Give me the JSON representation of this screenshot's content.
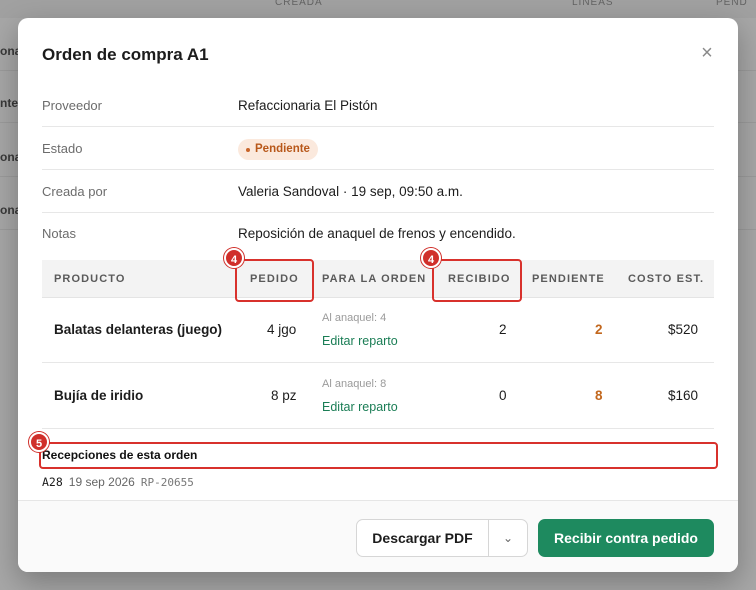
{
  "background": {
    "col_creada": "CREADA",
    "col_lineas": "LINEAS",
    "col_pend": "PEND",
    "row_texts": [
      "ona",
      "nte",
      "ona",
      "ona"
    ]
  },
  "modal": {
    "title": "Orden de compra A1",
    "close_glyph": "×",
    "info": {
      "proveedor_label": "Proveedor",
      "proveedor_value": "Refaccionaria El Pistón",
      "estado_label": "Estado",
      "estado_value": "Pendiente",
      "creada_label": "Creada por",
      "creada_value": "Valeria Sandoval · 19 sep, 09:50 a.m.",
      "notas_label": "Notas",
      "notas_value": "Reposición de anaquel de frenos y encendido."
    },
    "table": {
      "headers": [
        "PRODUCTO",
        "PEDIDO",
        "PARA LA ORDEN",
        "RECIBIDO",
        "PENDIENTE",
        "COSTO EST."
      ],
      "rows": [
        {
          "product": "Balatas delanteras (juego)",
          "ordered": "4 jgo",
          "alloc_label": "Al anaquel: 4",
          "alloc_link": "Editar reparto",
          "received": "2",
          "pending": "2",
          "cost": "$520"
        },
        {
          "product": "Bujía de iridio",
          "ordered": "8 pz",
          "alloc_label": "Al anaquel: 8",
          "alloc_link": "Editar reparto",
          "received": "0",
          "pending": "8",
          "cost": "$160"
        }
      ]
    },
    "receptions": {
      "title": "Recepciones de esta orden",
      "items": [
        {
          "id": "A28",
          "date": "19 sep 2026",
          "ref": "RP-20655"
        }
      ]
    },
    "footer": {
      "pdf_label": "Descargar PDF",
      "caret": "⌄",
      "primary_label": "Recibir contra pedido"
    },
    "annotations": {
      "badge_pedido": "4",
      "badge_recibido": "4",
      "badge_recepciones": "5"
    }
  },
  "colors": {
    "accent_green": "#1e8a5f",
    "pending_orange": "#c2671d",
    "annotation_red": "#d8312c"
  }
}
